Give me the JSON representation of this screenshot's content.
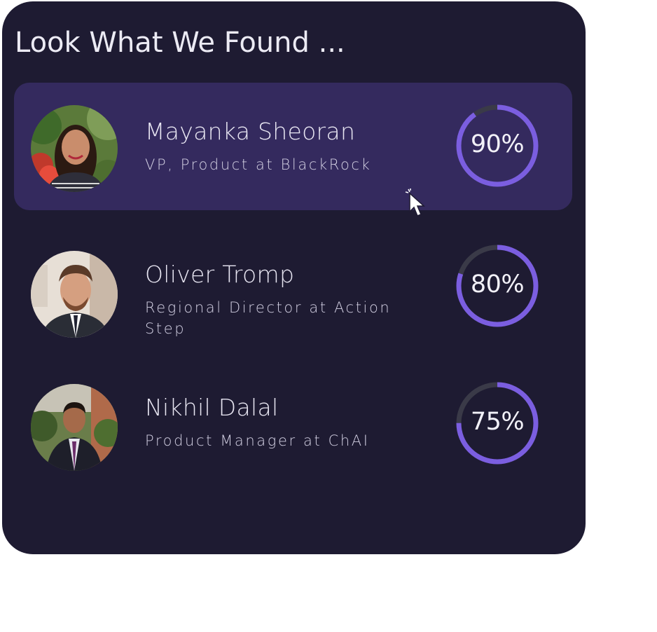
{
  "page": {
    "title": "Look What We Found ..."
  },
  "colors": {
    "card_background": "#1e1b32",
    "highlight_row": "#342a5e",
    "ring_accent": "#7b5ee0",
    "ring_track": "#3a3a48",
    "text_primary": "#e8e6f2"
  },
  "matches": [
    {
      "name": "Mayanka Sheoran",
      "role": "VP, Product at BlackRock",
      "score_label": "90%",
      "score": 0.9,
      "highlighted": true,
      "avatar_icon": "woman-portrait"
    },
    {
      "name": "Oliver Tromp",
      "role": "Regional Director at Action Step",
      "score_label": "80%",
      "score": 0.8,
      "highlighted": false,
      "avatar_icon": "man-portrait-suit"
    },
    {
      "name": "Nikhil Dalal",
      "role": "Product Manager at ChAI",
      "score_label": "75%",
      "score": 0.75,
      "highlighted": false,
      "avatar_icon": "man-portrait-outdoor"
    }
  ],
  "cursor": {
    "icon": "mouse-pointer-icon"
  }
}
